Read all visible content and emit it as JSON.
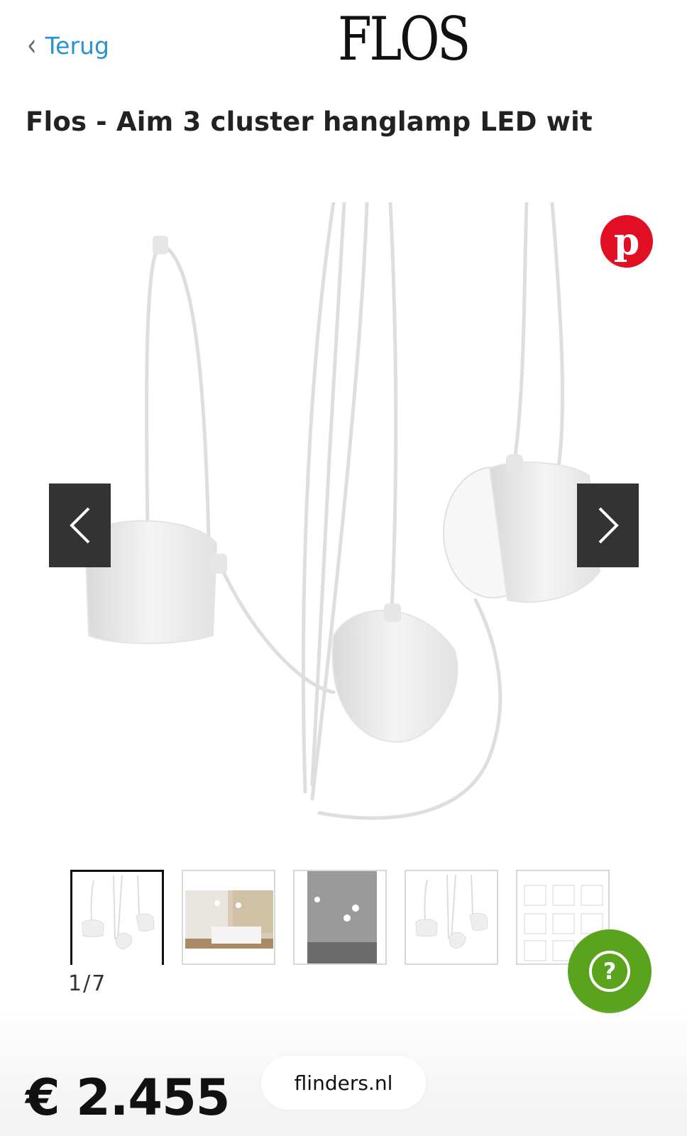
{
  "header": {
    "back_label": "Terug",
    "brand": "FLOS"
  },
  "product": {
    "title": "Flos - Aim 3 cluster hanglamp LED wit",
    "price": "€ 2.455"
  },
  "gallery": {
    "counter": "1/7",
    "thumbnail_count": 5,
    "active_index": 0
  },
  "icons": {
    "back": "chevron-left-icon",
    "pinterest": "pinterest-icon",
    "prev": "chevron-left-icon",
    "next": "chevron-right-icon",
    "help": "question-icon"
  },
  "browser": {
    "domain": "flinders.nl"
  },
  "colors": {
    "link": "#2a92cf",
    "pinterest": "#e10e24",
    "help": "#5aa31c",
    "arrow_bg": "#333333"
  }
}
